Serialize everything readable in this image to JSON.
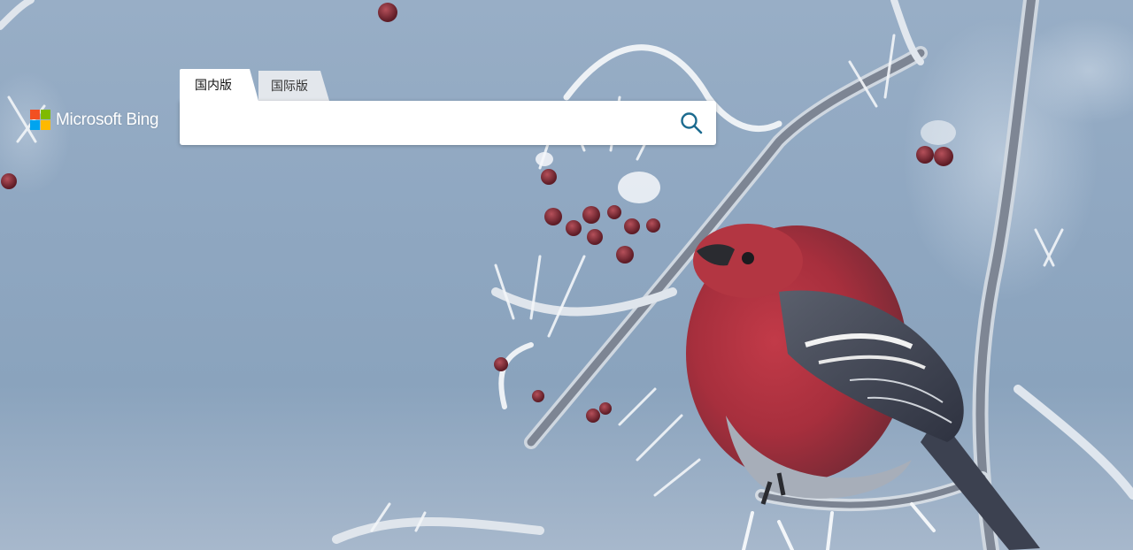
{
  "logo": {
    "text": "Microsoft Bing",
    "colors": [
      "#f25022",
      "#7fba00",
      "#00a4ef",
      "#ffb900"
    ]
  },
  "tabs": [
    {
      "label": "国内版",
      "active": true
    },
    {
      "label": "国际版",
      "active": false
    }
  ],
  "search": {
    "value": "",
    "placeholder": "",
    "icon": "search-icon",
    "icon_color": "#1c6b8f"
  },
  "background": {
    "description_icon": "frosted-branch-bird-photo"
  }
}
